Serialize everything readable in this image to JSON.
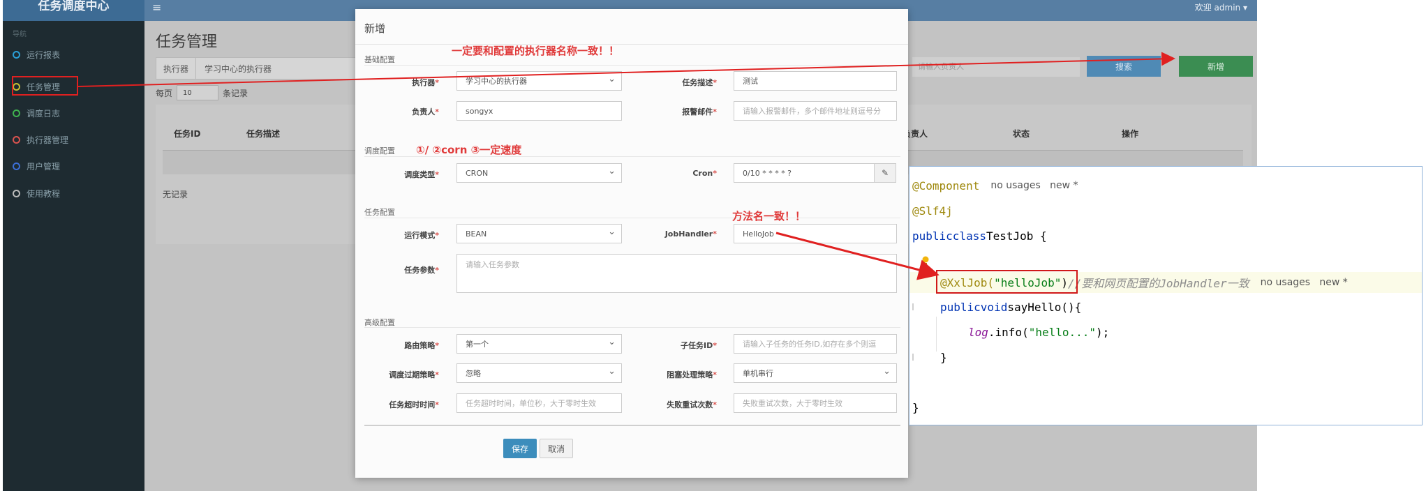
{
  "app": {
    "brand": "任务调度中心",
    "hamburger_icon": "menu-icon",
    "user_menu": "欢迎 admin ▾"
  },
  "sidebar": {
    "header": "导航",
    "items": [
      {
        "label": "运行报表",
        "dot_color": "#2a9fd6"
      },
      {
        "label": "任务管理",
        "dot_color": "#c9c032"
      },
      {
        "label": "调度日志",
        "dot_color": "#3fb34f"
      },
      {
        "label": "执行器管理",
        "dot_color": "#d9534f"
      },
      {
        "label": "用户管理",
        "dot_color": "#3c6fd6"
      },
      {
        "label": "使用教程",
        "dot_color": "#bbbbbb"
      }
    ]
  },
  "main": {
    "title": "任务管理",
    "executor_filter_label": "执行器",
    "executor_filter_value": "学习中心的执行器",
    "search_placeholder": "请输入负责人",
    "search_button": "搜索",
    "add_button": "新增",
    "page_size_prefix": "每页",
    "page_size_value": "10",
    "page_size_suffix": "条记录",
    "table_headers": [
      "任务ID",
      "任务描述",
      "负责人",
      "状态",
      "操作"
    ],
    "empty_text": "无记录"
  },
  "modal": {
    "title": "新增",
    "sections": {
      "basic": "基础配置",
      "schedule": "调度配置",
      "task": "任务配置",
      "advanced": "高级配置"
    },
    "fields": {
      "executor_label": "执行器",
      "executor_value": "学习中心的执行器",
      "desc_label": "任务描述",
      "desc_value": "测试",
      "owner_label": "负责人",
      "owner_value": "songyx",
      "alarm_label": "报警邮件",
      "alarm_placeholder": "请输入报警邮件，多个邮件地址则逗号分",
      "schedule_type_label": "调度类型",
      "schedule_type_value": "CRON",
      "cron_label": "Cron",
      "cron_value": "0/10 * * * * ?",
      "run_mode_label": "运行模式",
      "run_mode_value": "BEAN",
      "handler_label": "JobHandler",
      "handler_value": "HelloJob",
      "params_label": "任务参数",
      "params_placeholder": "请输入任务参数",
      "route_label": "路由策略",
      "route_value": "第一个",
      "child_label": "子任务ID",
      "child_placeholder": "请输入子任务的任务ID,如存在多个则逗",
      "misfire_label": "调度过期策略",
      "misfire_value": "忽略",
      "block_label": "阻塞处理策略",
      "block_value": "单机串行",
      "timeout_label": "任务超时时间",
      "timeout_placeholder": "任务超时时间，单位秒，大于零时生效",
      "retry_label": "失败重试次数",
      "retry_placeholder": "失败重试次数，大于零时生效"
    },
    "save_button": "保存",
    "cancel_button": "取消",
    "cron_edit_icon": "edit-icon"
  },
  "annotations": {
    "executor_note": "一定要和配置的执行器名称一致！！",
    "cron_note": "①/ ②corn ③一定速度",
    "method_note": "方法名一致！！"
  },
  "code": {
    "line1_annotation": "@Component",
    "line1_hint": "no usages   new *",
    "line2_annotation": "@Slf4j",
    "line3_public": "public",
    "line3_class": "class",
    "line3_name": "TestJob {",
    "line5_annotation": "@XxlJob(",
    "line5_string": "\"helloJob\"",
    "line5_close": ")",
    "line5_comment": "//要和网页配置的JobHandler一致",
    "line5_hint": "no usages   new *",
    "line6_public": "public",
    "line6_void": "void",
    "line6_name": "sayHello(){",
    "line7_log": "log",
    "line7_call": ".info(",
    "line7_string": "\"hello...\"",
    "line7_end": ");",
    "line8_brace": "}",
    "line10_brace": "}",
    "bulb_icon": "lightbulb-icon"
  },
  "colors": {
    "annotation_red": "#e02020",
    "sidebar_bg": "#1e2b31",
    "topbar": "#577ea3",
    "primary_button": "#3c8dbc"
  }
}
